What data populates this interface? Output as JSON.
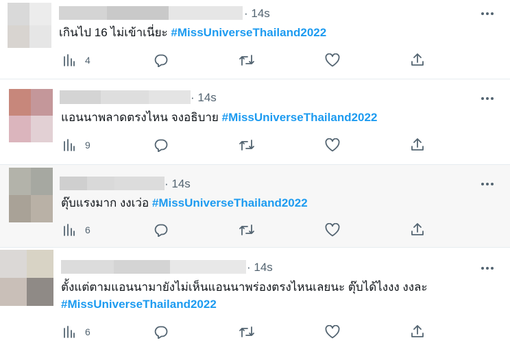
{
  "colors": {
    "accent": "#1d9bf0",
    "text": "#0f1419",
    "muted": "#536471",
    "hover_bg": "#f7f7f7"
  },
  "icons": {
    "stats": "bar-chart-icon",
    "reply": "speech-bubble-icon",
    "retweet": "retweet-arrows-icon",
    "like": "heart-icon",
    "share": "upload-arrow-icon",
    "more": "ellipsis-icon"
  },
  "tweets": [
    {
      "time": "· 14s",
      "text": "เกินไป 16 ไม่เข้าเนี่ยะ",
      "text2": "",
      "hashtag": "#MissUniverseThailand2022",
      "views": "4"
    },
    {
      "time": "· 14s",
      "text": "แอนนาพลาดตรงไหน จงอธิบาย",
      "text2": "",
      "hashtag": "#MissUniverseThailand2022",
      "views": "9"
    },
    {
      "time": "· 14s",
      "text": "ตุ๊บแรงมาก งงเว่อ",
      "text2": "",
      "hashtag": "#MissUniverseThailand2022",
      "views": "6"
    },
    {
      "time": "· 14s",
      "text": "ตั้งแต่ตามแอนนามายังไม่เห็นแอนนาพร่องตรงไหนเลยนะ ตุ๊บได้ไงงง งงละ",
      "text2": "",
      "hashtag": "#MissUniverseThailand2022",
      "views": "6"
    }
  ]
}
